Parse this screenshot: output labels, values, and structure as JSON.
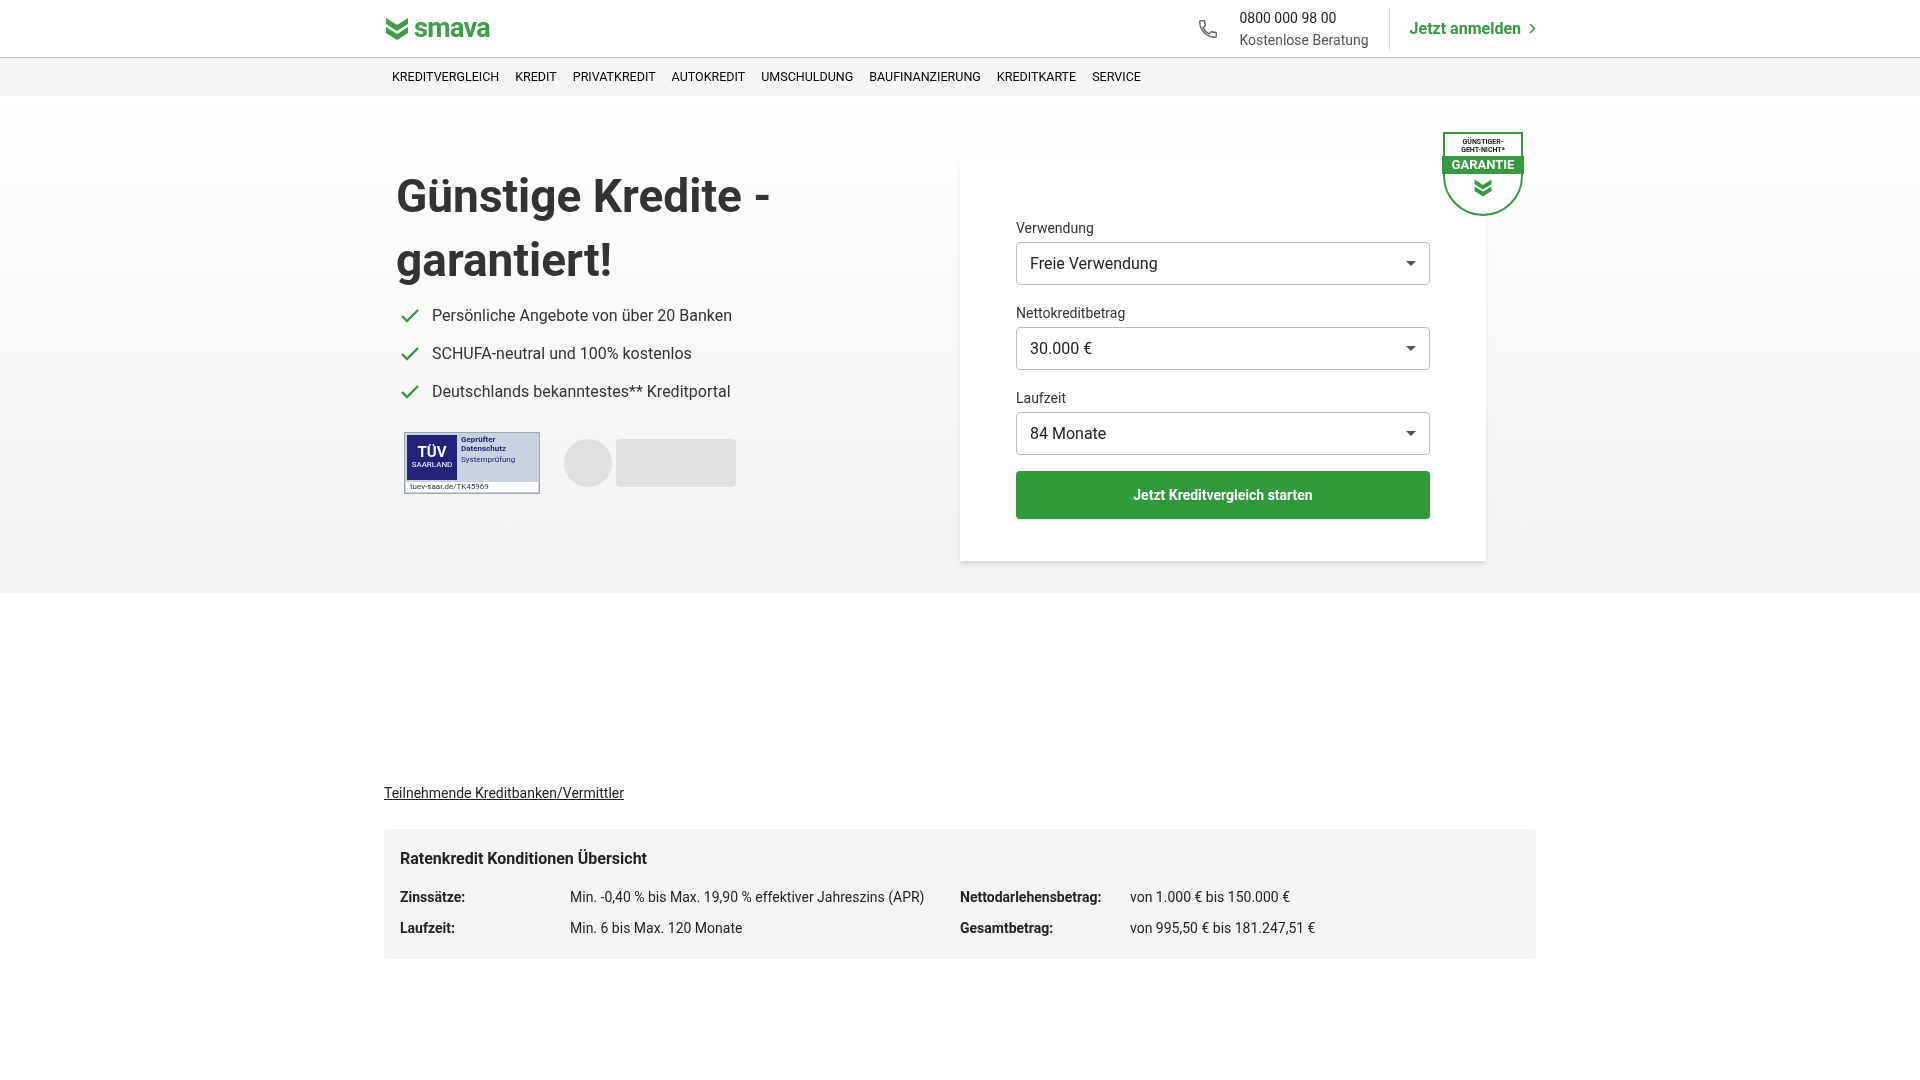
{
  "header": {
    "logo": "smava",
    "phone": "0800 000 98 00",
    "phone_note": "Kostenlose Beratung",
    "login": "Jetzt anmelden"
  },
  "nav": [
    "KREDITVERGLEICH",
    "KREDIT",
    "PRIVATKREDIT",
    "AUTOKREDIT",
    "UMSCHULDUNG",
    "BAUFINANZIERUNG",
    "KREDITKARTE",
    "SERVICE"
  ],
  "hero": {
    "title": "Günstige Kredite - garantiert!",
    "benefits": [
      "Persönliche Angebote von über 20 Banken",
      "SCHUFA-neutral und 100% kostenlos",
      "Deutschlands bekanntestes** Kreditportal"
    ],
    "tuev_badge": {
      "mark": "TÜV",
      "region": "SAARLAND",
      "title": "Geprüfter Datenschutz",
      "subtitle": "Systemprüfung",
      "url": "tuev-saar.de/TK45969"
    }
  },
  "form": {
    "badge": {
      "top": "GÜNSTIGER-",
      "middle": "GEHT-NICHT*",
      "label": "GARANTIE"
    },
    "fields": [
      {
        "label": "Verwendung",
        "value": "Freie Verwendung"
      },
      {
        "label": "Nettokreditbetrag",
        "value": "30.000 €"
      },
      {
        "label": "Laufzeit",
        "value": "84 Monate"
      }
    ],
    "submit": "Jetzt Kreditvergleich starten"
  },
  "banks_link": "Teilnehmende Kreditbanken/Vermittler",
  "conditions": {
    "title": "Ratenkredit Konditionen Übersicht",
    "rows": [
      {
        "label": "Zinssätze:",
        "value": "Min. -0,40 % bis Max. 19,90 % effektiver Jahreszins (APR)"
      },
      {
        "label": "Nettodarlehensbetrag:",
        "value": "von 1.000 € bis 150.000 €"
      },
      {
        "label": "Laufzeit:",
        "value": "Min. 6 bis Max. 120 Monate"
      },
      {
        "label": "Gesamtbetrag:",
        "value": "von 995,50 € bis 181.247,51 €"
      }
    ]
  }
}
